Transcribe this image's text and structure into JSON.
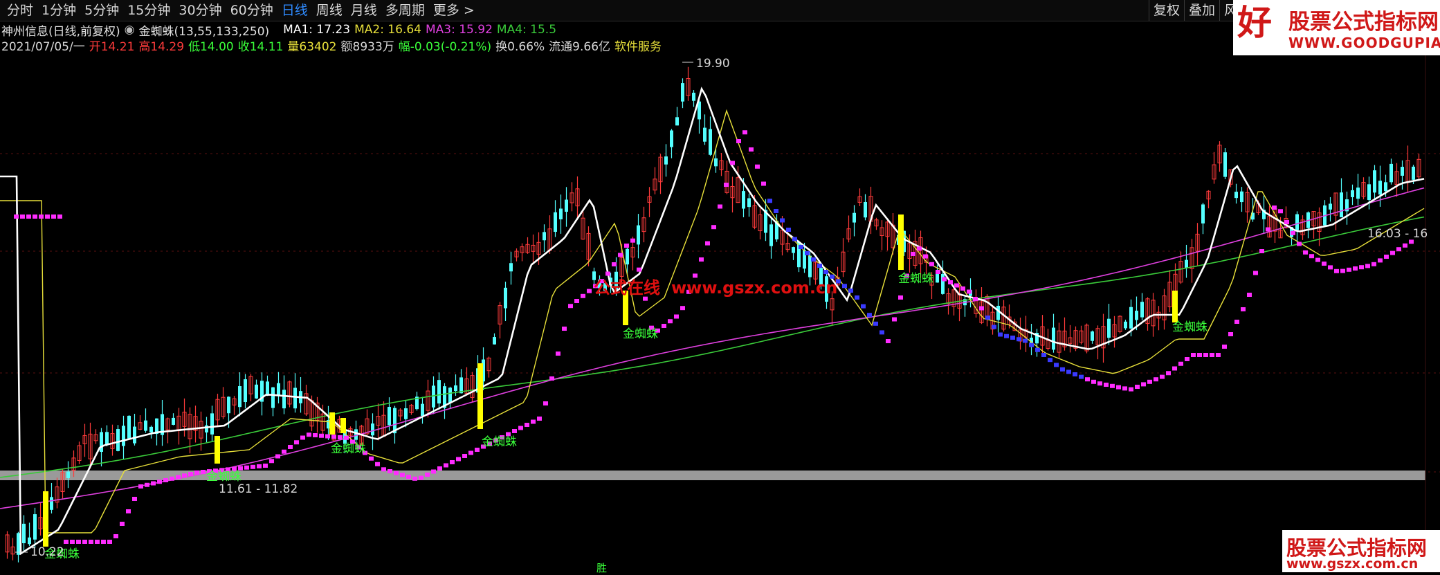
{
  "toolbar": {
    "periods": [
      "分时",
      "1分钟",
      "5分钟",
      "15分钟",
      "30分钟",
      "60分钟",
      "日线",
      "周线",
      "月线",
      "多周期",
      "更多 >"
    ],
    "active": "日线",
    "right_buttons": [
      "复权",
      "叠加",
      "风"
    ]
  },
  "info": {
    "stock": "神州信息(日线,前复权)",
    "indicator": "金蜘蛛(13,55,133,250)",
    "ma1": "MA1: 17.23",
    "ma2": "MA2: 16.64",
    "ma3": "MA3: 15.92",
    "ma4": "MA4: 15.5",
    "date": "2021/07/05/一",
    "open": "开14.21",
    "high": "高14.29",
    "low": "低14.00",
    "close": "收14.11",
    "volume": "量63402",
    "amount": "额8933万",
    "change": "幅-0.03(-0.21%)",
    "turnover": "换0.66%",
    "float": "流通9.66亿",
    "service": "软件服务"
  },
  "annotations": {
    "high_price": "19.90",
    "low_price": "10.22",
    "range1": "11.61 - 11.82",
    "range2": "16.03 - 16",
    "signal": "金蜘蛛",
    "bottom_marker": "胜"
  },
  "watermarks": {
    "top_char": "好",
    "top_title": "股票公式指标网",
    "top_url": "WWW.GOODGUPIAO.COM",
    "mid_text": "公式在线",
    "mid_url": "www.gszx.com.cn",
    "bot_title": "股票公式指标网",
    "bot_url": "www.gszx.com.cn"
  },
  "colors": {
    "up": "#ff3b3b",
    "down": "#54ffff",
    "ma1": "#ffffff",
    "ma2": "#e8e03a",
    "ma3": "#e040e0",
    "ma4": "#3acb3a",
    "spider": "#ff2cff",
    "signal_bar": "#ffff00",
    "signal_text": "#3aff3a",
    "accent": "#2f8bff"
  }
}
